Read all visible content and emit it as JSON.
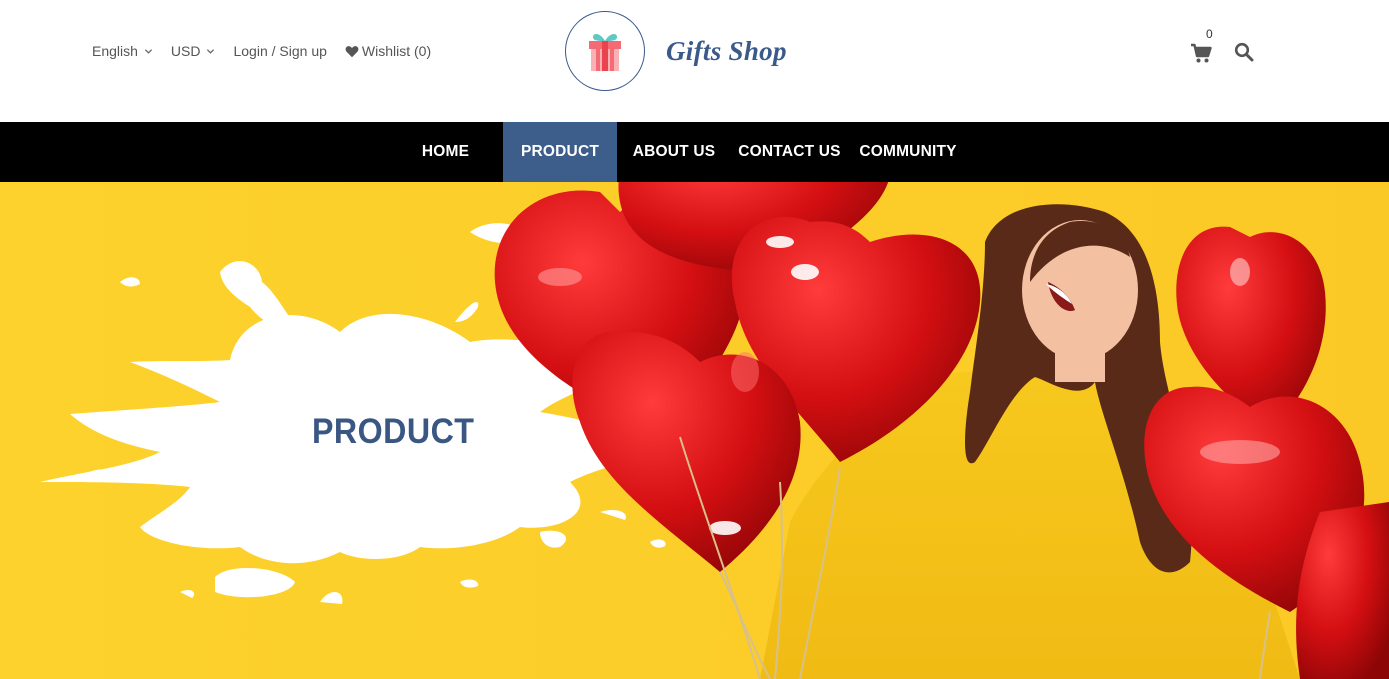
{
  "header": {
    "language": "English",
    "currency": "USD",
    "login_label": "Login / Sign up",
    "wishlist_label": "Wishlist (0)",
    "shop_name": "Gifts Shop",
    "cart_count": "0"
  },
  "nav": {
    "items": [
      {
        "label": "HOME"
      },
      {
        "label": "PRODUCT"
      },
      {
        "label": "ABOUT US"
      },
      {
        "label": "CONTACT US"
      },
      {
        "label": "COMMUNITY"
      }
    ],
    "active": "PRODUCT"
  },
  "banner": {
    "title": "PRODUCT"
  },
  "colors": {
    "brand": "#3a5a8a",
    "nav_bg": "#000000",
    "nav_active": "#3d5d8b",
    "banner_bg": "#fdd02b",
    "balloon": "#d40f12"
  },
  "icons": [
    "chevron-down-icon",
    "heart-icon",
    "gift-icon",
    "cart-icon",
    "search-icon"
  ]
}
